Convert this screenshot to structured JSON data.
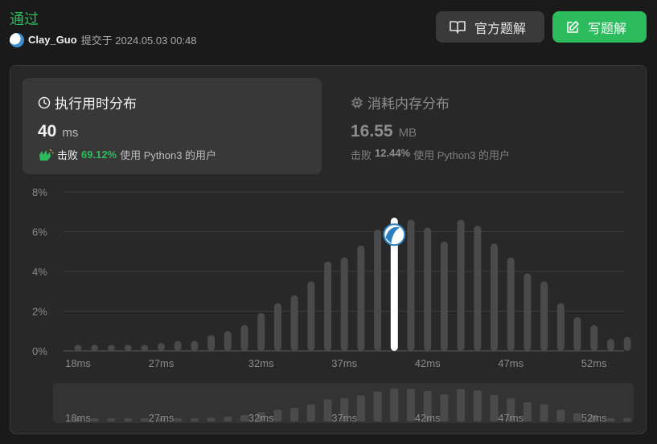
{
  "header": {
    "status": "通过",
    "username": "Clay_Guo",
    "submitted_text": "提交于 2024.05.03 00:48",
    "official_solution_label": "官方题解",
    "write_solution_label": "写题解"
  },
  "runtime": {
    "title": "执行用时分布",
    "value": "40",
    "unit": "ms",
    "beats_label": "击败",
    "beats_pct": "69.12%",
    "beats_suffix": "使用 Python3 的用户"
  },
  "memory": {
    "title": "消耗内存分布",
    "value": "16.55",
    "unit": "MB",
    "beats_label": "击败",
    "beats_pct": "12.44%",
    "beats_suffix": "使用 Python3 的用户"
  },
  "colors": {
    "accent": "#2cbb5d",
    "bar": "#4a4a4a",
    "highlight": "#ffffff"
  },
  "chart_data": {
    "type": "bar",
    "title": "",
    "xlabel": "",
    "ylabel": "",
    "ylim": [
      0,
      8
    ],
    "y_ticks": [
      "8%",
      "6%",
      "4%",
      "2%",
      "0%"
    ],
    "y_tick_values": [
      8,
      6,
      4,
      2,
      0
    ],
    "x_tick_labels": [
      "18ms",
      "27ms",
      "32ms",
      "37ms",
      "42ms",
      "47ms",
      "52ms"
    ],
    "x_tick_bar_index": [
      0,
      5,
      11,
      16,
      21,
      26,
      31
    ],
    "values": [
      0.3,
      0.3,
      0.3,
      0.3,
      0.3,
      0.4,
      0.5,
      0.5,
      0.8,
      1.0,
      1.3,
      1.9,
      2.4,
      2.8,
      3.5,
      4.5,
      4.7,
      5.3,
      6.1,
      6.7,
      6.6,
      6.2,
      5.5,
      6.6,
      6.3,
      5.4,
      4.7,
      3.9,
      3.5,
      2.4,
      1.7,
      1.3,
      0.6,
      0.7
    ],
    "highlight_index": 19,
    "grid": true
  }
}
